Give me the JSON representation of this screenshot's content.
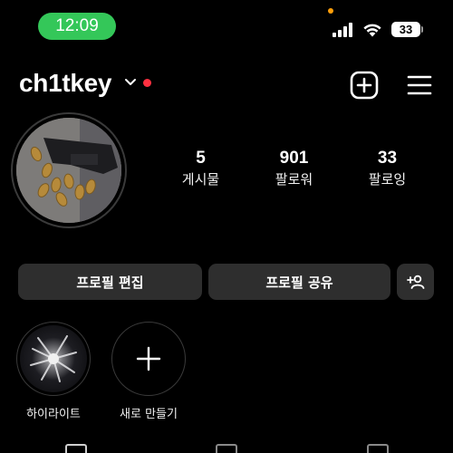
{
  "status_bar": {
    "time": "12:09",
    "battery": "33"
  },
  "header": {
    "username": "ch1tkey"
  },
  "stats": [
    {
      "value": "5",
      "label": "게시물"
    },
    {
      "value": "901",
      "label": "팔로워"
    },
    {
      "value": "33",
      "label": "팔로잉"
    }
  ],
  "buttons": {
    "edit_profile": "프로필 편집",
    "share_profile": "프로필 공유"
  },
  "highlights": [
    {
      "label": "하이라이트"
    },
    {
      "label": "새로 만들기"
    }
  ],
  "colors": {
    "time_pill": "#34c759",
    "notification_dot": "#ff3040",
    "privacy_dot": "#ff9f0a",
    "button_bg": "#2e2e2e"
  },
  "icons": {
    "add": "plus-square-icon",
    "menu": "hamburger-menu-icon",
    "discover_people": "add-person-icon",
    "new_highlight": "plus-icon"
  }
}
